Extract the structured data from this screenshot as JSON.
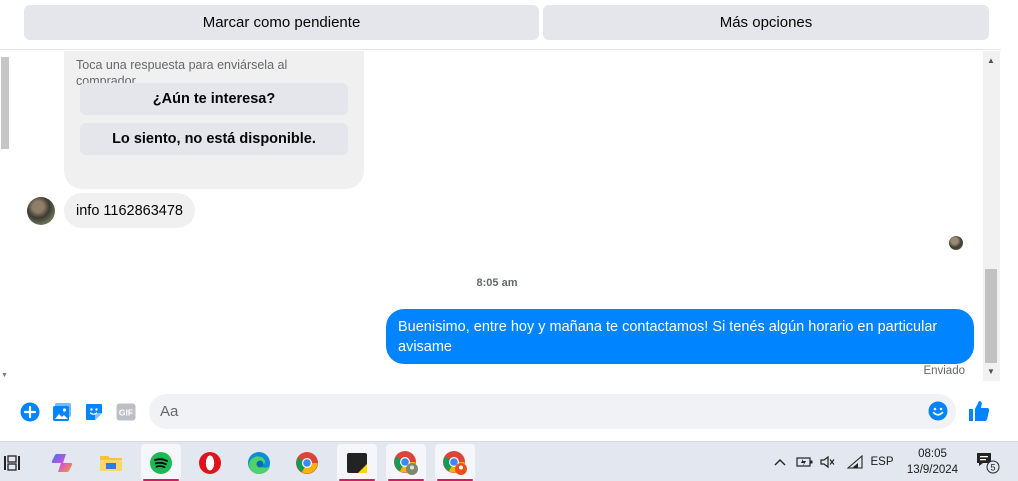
{
  "top_actions": {
    "mark_pending": "Marcar como pendiente",
    "more_options": "Más opciones"
  },
  "chat": {
    "quick_replies_hint": "Toca una respuesta para enviársela al comprador.",
    "quick_replies": [
      "¿Aún te interesa?",
      "Lo siento, no está disponible."
    ],
    "incoming_message": "info 1162863478",
    "timestamp": "8:05 am",
    "outgoing_message": "Buenisimo, entre hoy y mañana te contactamos! Si tenés algún horario en particular avisame",
    "status": "Enviado"
  },
  "composer": {
    "placeholder": "Aa",
    "gif_label": "GIF",
    "accent_color": "#0084ff"
  },
  "taskbar": {
    "apps": [
      "task-view",
      "copilot",
      "file-explorer",
      "spotify",
      "opera",
      "edge",
      "chrome",
      "sticky-notes",
      "chrome-profile-1",
      "chrome-profile-2"
    ],
    "language": "ESP",
    "time": "08:05",
    "date": "13/9/2024",
    "notification_count": "5"
  }
}
